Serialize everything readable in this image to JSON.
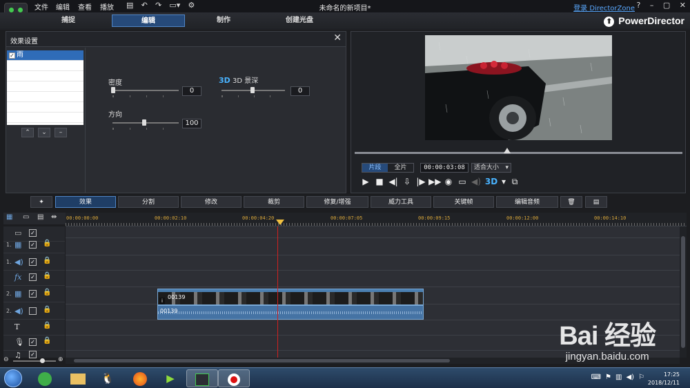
{
  "window": {
    "title": "未命名的新项目*",
    "menu": [
      "文件",
      "编辑",
      "查看",
      "播放"
    ],
    "dz_link": "登录 DirectorZone",
    "help": "?",
    "brand": "PowerDirector"
  },
  "modes": [
    "捕捉",
    "编辑",
    "制作",
    "创建光盘"
  ],
  "active_mode": "编辑",
  "effect_panel": {
    "title": "效果设置",
    "items": [
      "雨"
    ],
    "params": {
      "density_label": "密度",
      "density_value": "0",
      "depth_label": "3D 景深",
      "depth_badge": "3D",
      "depth_value": "0",
      "direction_label": "方向",
      "direction_value": "100"
    }
  },
  "preview": {
    "seg_tabs": [
      "片段",
      "全片"
    ],
    "active_seg": "片段",
    "timecode": "00:00:03:08",
    "fit": "适合大小",
    "three_d": "3D"
  },
  "function_tabs": [
    "效果",
    "分割",
    "修改",
    "裁剪",
    "修复/增强",
    "威力工具",
    "关键帧",
    "编辑音频"
  ],
  "active_function": "效果",
  "timeline": {
    "ruler": [
      "00:00:00:00",
      "00:00:02:10",
      "00:00:04:20",
      "00:00:07:05",
      "00:00:09:15",
      "00:00:12:00",
      "00:00:14:10"
    ],
    "tracks": [
      {
        "num": "",
        "icon": "video-icon",
        "checked": true
      },
      {
        "num": "1.",
        "icon": "video-icon",
        "checked": true
      },
      {
        "num": "1.",
        "icon": "audio-icon",
        "checked": true
      },
      {
        "num": "",
        "icon": "fx-icon",
        "checked": true
      },
      {
        "num": "2.",
        "icon": "video-icon",
        "checked": true
      },
      {
        "num": "2.",
        "icon": "audio-icon",
        "checked": false
      },
      {
        "num": "",
        "icon": "title-icon",
        "checked": null
      },
      {
        "num": "",
        "icon": "voice-icon",
        "checked": true
      },
      {
        "num": "",
        "icon": "music-icon",
        "checked": true
      }
    ],
    "clip_video_label": "00139",
    "clip_audio_label": "00139"
  },
  "taskbar": {
    "time": "17:25",
    "date": "2018/12/11"
  },
  "watermark": {
    "logo": "Bai 经验",
    "sub": "jingyan.baidu.com"
  }
}
